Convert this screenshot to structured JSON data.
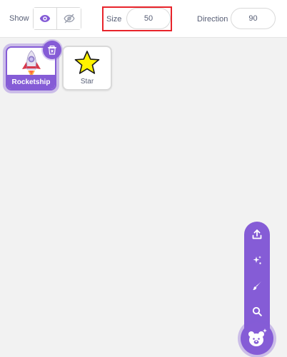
{
  "controls": {
    "show_label": "Show",
    "size_label": "Size",
    "size_value": "50",
    "direction_label": "Direction",
    "direction_value": "90"
  },
  "sprites": [
    {
      "name": "Rocketship",
      "selected": true,
      "icon": "rocketship-icon"
    },
    {
      "name": "Star",
      "selected": false,
      "icon": "star-icon"
    }
  ],
  "add_sprite_menu": {
    "items": [
      "upload-icon",
      "surprise-icon",
      "paint-icon",
      "search-icon"
    ],
    "main_icon": "bear-icon"
  },
  "colors": {
    "accent": "#855cd6",
    "highlight_box": "#e8242b",
    "background": "#f2f2f2",
    "text": "#575e75"
  }
}
